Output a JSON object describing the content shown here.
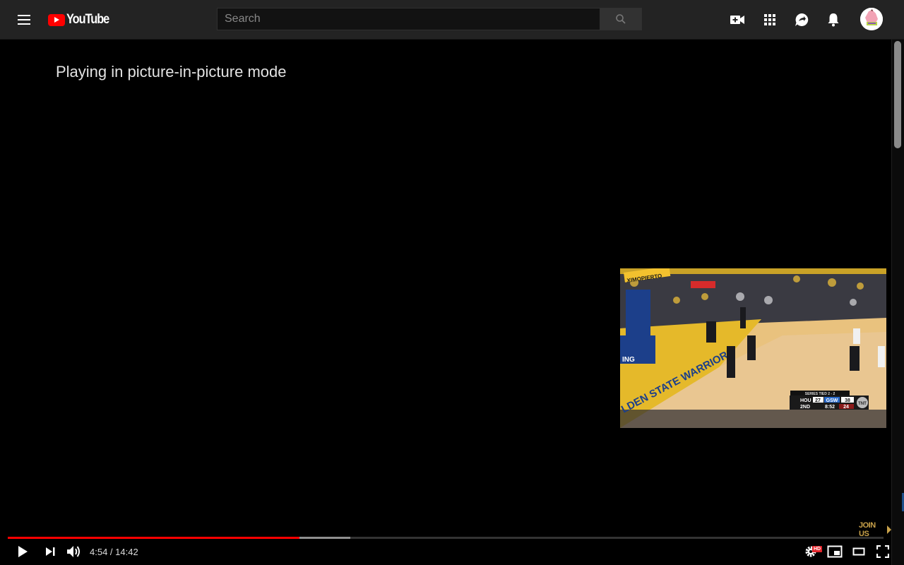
{
  "masthead": {
    "logo_text": "YouTube",
    "search": {
      "placeholder": "Search",
      "value": ""
    },
    "icons": [
      "menu-icon",
      "create-video-icon",
      "apps-grid-icon",
      "messages-icon",
      "notifications-bell-icon",
      "avatar"
    ]
  },
  "player": {
    "pip_message": "Playing in picture-in-picture mode",
    "current_time": "4:54",
    "duration": "14:42",
    "time_display": "4:54 / 14:42",
    "played_fraction": 0.3333,
    "buffered_fraction": 0.3915,
    "hd_badge": "HD",
    "join_label": "JOIN US",
    "colors": {
      "progress_played": "#ff0000",
      "join_accent": "#c9a24a",
      "hd_badge": "#e3242b"
    }
  },
  "pip_video": {
    "scoreboard": {
      "series_text": "SERIES TIED 2 - 2",
      "away_team": "HOU",
      "away_score": "27",
      "home_team": "GSW",
      "home_score": "38",
      "period": "2ND",
      "clock": "8:52",
      "shot_clock": "24",
      "network": "TNT"
    },
    "banner_text": "XIMOPIERTO",
    "court_text": "LDEN STATE WARRIORS"
  }
}
